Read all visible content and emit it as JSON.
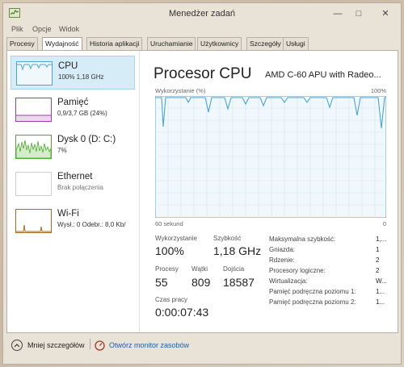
{
  "window": {
    "title": "Menedżer zadań",
    "minimize_glyph": "—",
    "maximize_glyph": "□",
    "close_glyph": "✕"
  },
  "menu": [
    "Plik",
    "Opcje",
    "Widok"
  ],
  "tabs": [
    "Procesy",
    "Wydajność",
    "Historia aplikacji",
    "Uruchamianie",
    "Użytkownicy",
    "Szczegóły",
    "Usługi"
  ],
  "active_tab": "Wydajność",
  "sidebar": {
    "items": [
      {
        "name": "CPU",
        "sub": "100% 1,18 GHz",
        "graph_color": "#4ba3d3",
        "selected": true
      },
      {
        "name": "Pamięć",
        "sub": "0,9/3,7 GB (24%)",
        "graph_color": "#9b3fa8"
      },
      {
        "name": "Dysk 0 (D: C:)",
        "sub": "7%",
        "graph_color": "#4ea832"
      },
      {
        "name": "Ethernet",
        "sub": "Brak połączenia",
        "graph_color": "#a86a1e"
      },
      {
        "name": "Wi-Fi",
        "sub": "Wysł.: 0 Odebr.: 8,0 Kb/",
        "graph_color": "#a86a1e"
      }
    ]
  },
  "main": {
    "title": "Procesor CPU",
    "model": "AMD C-60 APU with Radeo...",
    "graph_label_left": "Wykorzystanie (%)",
    "graph_label_right": "100%",
    "graph_foot_left": "60 sekund",
    "graph_foot_right": "0",
    "graph_color": "#4ba3d3",
    "stats": {
      "usage_label": "Wykorzystanie",
      "usage_value": "100%",
      "speed_label": "Szybkość",
      "speed_value": "1,18 GHz",
      "processes_label": "Procesy",
      "processes_value": "55",
      "threads_label": "Wątki",
      "threads_value": "809",
      "handles_label": "Dojścia",
      "handles_value": "18587",
      "uptime_label": "Czas pracy",
      "uptime_value": "0:00:07:43"
    },
    "info": [
      {
        "label": "Maksymalna szybkość:",
        "value": "1,..."
      },
      {
        "label": "Gniazda:",
        "value": "1"
      },
      {
        "label": "Rdzenie:",
        "value": "2"
      },
      {
        "label": "Procesory logiczne:",
        "value": "2"
      },
      {
        "label": "Wirtualizacja:",
        "value": "W..."
      },
      {
        "label": "Pamięć podręczna poziomu 1:",
        "value": "1..."
      },
      {
        "label": "Pamięć podręczna poziomu 2:",
        "value": "1..."
      }
    ]
  },
  "footer": {
    "fewer_details": "Mniej szczegółów",
    "resource_monitor": "Otwórz monitor zasobów"
  }
}
